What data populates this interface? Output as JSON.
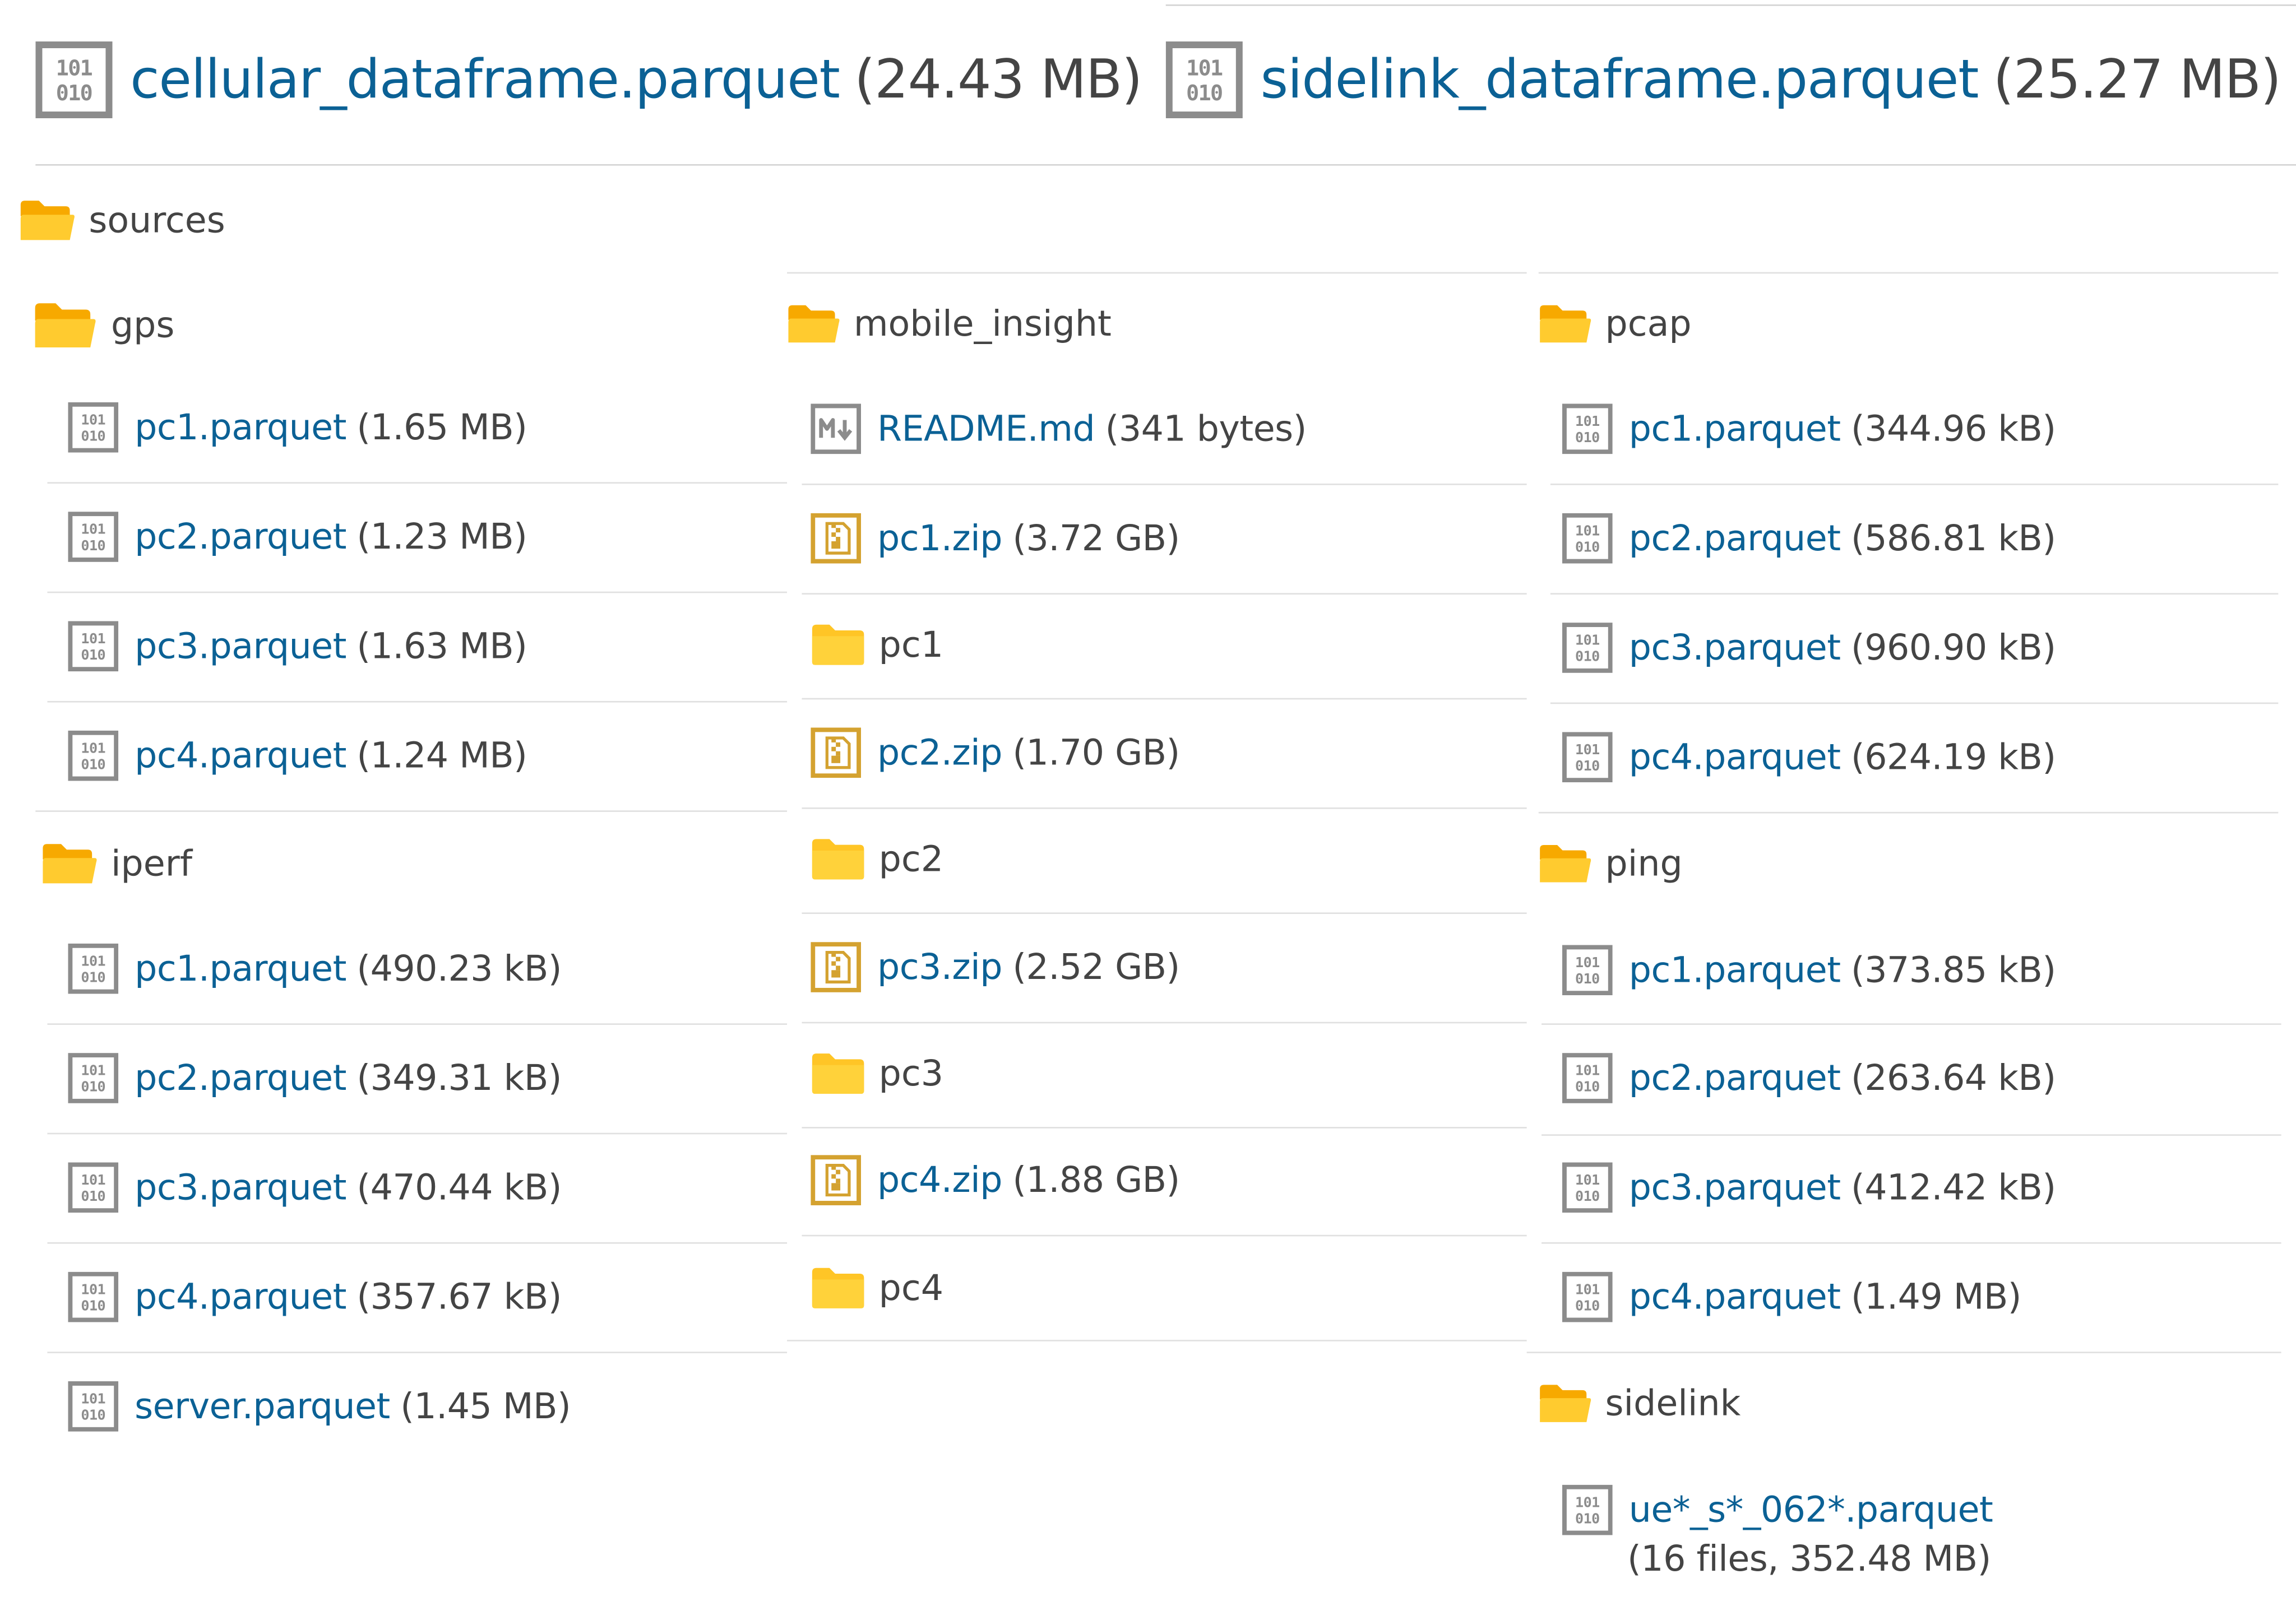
{
  "top_files": [
    {
      "name": "cellular_dataframe.parquet",
      "size": "(24.43 MB)"
    },
    {
      "name": "sidelink_dataframe.parquet",
      "size": "(25.27 MB)"
    }
  ],
  "root_folder": "sources",
  "columns": [
    {
      "folders": [
        {
          "name": "gps",
          "files": [
            {
              "name": "pc1.parquet",
              "size": "(1.65 MB)"
            },
            {
              "name": "pc2.parquet",
              "size": "(1.23 MB)"
            },
            {
              "name": "pc3.parquet",
              "size": "(1.63 MB)"
            },
            {
              "name": "pc4.parquet",
              "size": "(1.24 MB)"
            }
          ]
        },
        {
          "name": "iperf",
          "files": [
            {
              "name": "pc1.parquet",
              "size": "(490.23 kB)"
            },
            {
              "name": "pc2.parquet",
              "size": "(349.31 kB)"
            },
            {
              "name": "pc3.parquet",
              "size": "(470.44 kB)"
            },
            {
              "name": "pc4.parquet",
              "size": "(357.67 kB)"
            },
            {
              "name": "server.parquet",
              "size": "(1.45 MB)"
            }
          ]
        }
      ]
    },
    {
      "folders": [
        {
          "name": "mobile_insight",
          "entries": [
            {
              "kind": "markdown",
              "name": "README.md",
              "size": "(341 bytes)"
            },
            {
              "kind": "zip",
              "name": "pc1.zip",
              "size": "(3.72 GB)"
            },
            {
              "kind": "folder",
              "name": "pc1"
            },
            {
              "kind": "zip",
              "name": "pc2.zip",
              "size": "(1.70 GB)"
            },
            {
              "kind": "folder",
              "name": "pc2"
            },
            {
              "kind": "zip",
              "name": "pc3.zip",
              "size": "(2.52 GB)"
            },
            {
              "kind": "folder",
              "name": "pc3"
            },
            {
              "kind": "zip",
              "name": "pc4.zip",
              "size": "(1.88 GB)"
            },
            {
              "kind": "folder",
              "name": "pc4"
            }
          ]
        }
      ]
    },
    {
      "folders": [
        {
          "name": "pcap",
          "files": [
            {
              "name": "pc1.parquet",
              "size": "(344.96 kB)"
            },
            {
              "name": "pc2.parquet",
              "size": "(586.81 kB)"
            },
            {
              "name": "pc3.parquet",
              "size": "(960.90 kB)"
            },
            {
              "name": "pc4.parquet",
              "size": "(624.19 kB)"
            }
          ]
        },
        {
          "name": "ping",
          "files": [
            {
              "name": "pc1.parquet",
              "size": "(373.85 kB)"
            },
            {
              "name": "pc2.parquet",
              "size": "(263.64 kB)"
            },
            {
              "name": "pc3.parquet",
              "size": "(412.42 kB)"
            },
            {
              "name": "pc4.parquet",
              "size": "(1.49 MB)"
            }
          ]
        },
        {
          "name": "sidelink",
          "files": [
            {
              "name": "ue*_s*_062*.parquet",
              "size": "(16 files, 352.48 MB)"
            }
          ]
        }
      ]
    }
  ],
  "colors": {
    "link": "#0b6195",
    "text": "#444444",
    "folder": "#f5b400",
    "zip": "#d4a230",
    "binary_icon": "#8c8c8c",
    "divider": "#e0e0e0"
  },
  "icons": {
    "binary": "binary-file-icon",
    "zip": "zip-file-icon",
    "markdown": "markdown-file-icon",
    "folder": "folder-icon"
  }
}
